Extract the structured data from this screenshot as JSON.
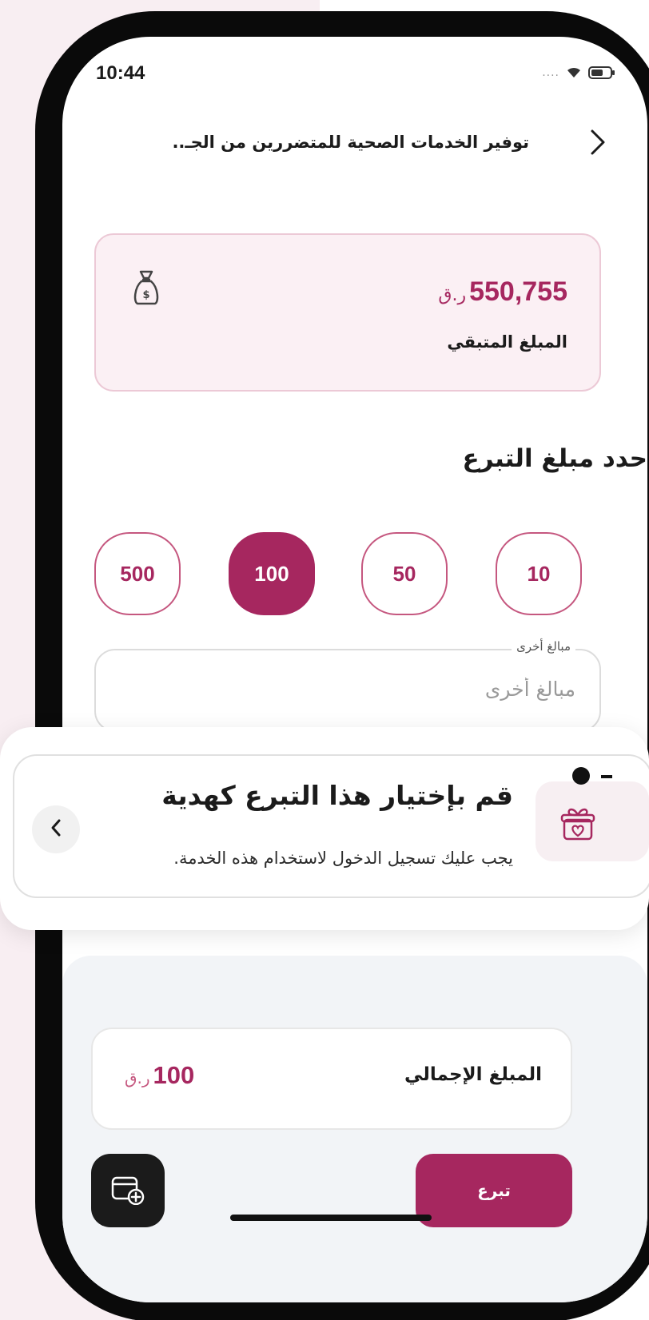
{
  "status_bar": {
    "time": "10:44",
    "signal_dots": "....",
    "icons": [
      "wifi-icon",
      "battery-icon"
    ]
  },
  "header": {
    "title": "توفير الخدمات الصحية للمتضررين من الجـ..",
    "back_icon": "chevron-right-icon"
  },
  "remaining": {
    "amount": "550,755",
    "currency": "ر.ق",
    "label": "المبلغ المتبقي",
    "icon": "moneybag-icon"
  },
  "donation": {
    "section_title": "حدد مبلغ التبرع",
    "amounts": [
      "500",
      "100",
      "50",
      "10"
    ],
    "selected_amount": "100",
    "other_label": "مبالغ أخرى",
    "other_placeholder": "مبالغ أخرى"
  },
  "gift_banner": {
    "title": "قم بإختيار هذا التبرع كهدية",
    "subtitle": "يجب عليك تسجيل الدخول لاستخدام هذه الخدمة.",
    "icon": "gift-icon",
    "chevron_icon": "chevron-left-icon"
  },
  "summary": {
    "total_label": "المبلغ الإجمالي",
    "total_value": "100",
    "currency": "ر.ق",
    "donate_label": "تبرع",
    "cart_icon": "cart-add-icon"
  },
  "colors": {
    "accent": "#a6275f",
    "accent_light": "#fbf0f4",
    "sheet_bg": "#f2f4f7"
  }
}
